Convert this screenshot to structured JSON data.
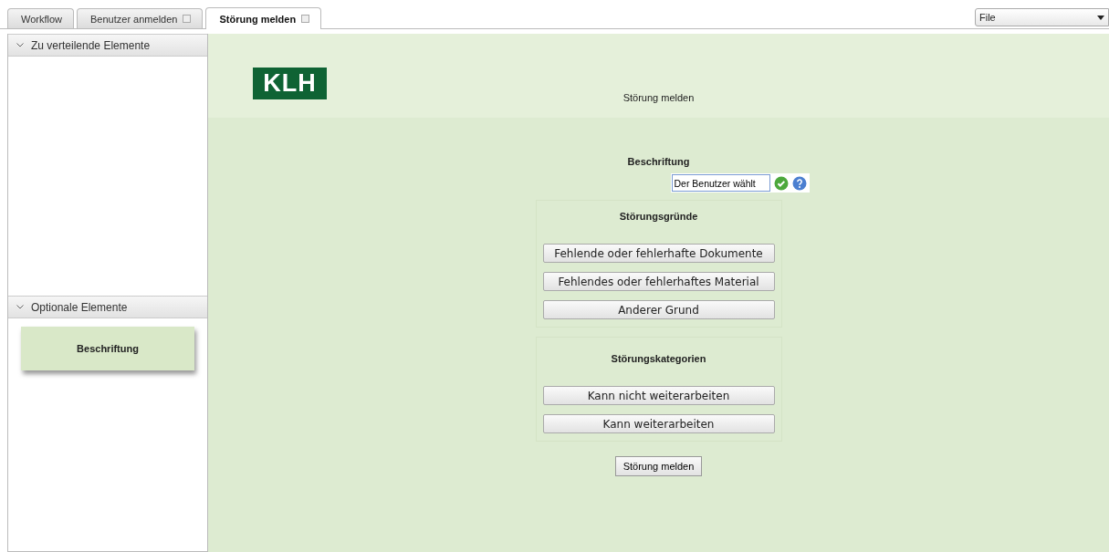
{
  "tabs": [
    {
      "label": "Workflow",
      "selected": false,
      "closable": false
    },
    {
      "label": "Benutzer anmelden",
      "selected": false,
      "closable": true
    },
    {
      "label": "Störung melden",
      "selected": true,
      "closable": true
    }
  ],
  "menu_dropdown": {
    "value": "File"
  },
  "sidebar": {
    "sections": [
      {
        "title": "Zu verteilende Elemente",
        "expanded": true
      },
      {
        "title": "Optionale Elemente",
        "expanded": true,
        "items": [
          "Beschriftung"
        ]
      }
    ]
  },
  "header": {
    "logo": "KLH",
    "title": "Störung melden"
  },
  "form": {
    "field_label": "Beschriftung",
    "field_value": "Der Benutzer wählt",
    "groups": [
      {
        "title": "Störungsgründe",
        "buttons": [
          "Fehlende oder fehlerhafte Dokumente",
          "Fehlendes oder fehlerhaftes Material",
          "Anderer Grund"
        ]
      },
      {
        "title": "Störungskategorien",
        "buttons": [
          "Kann nicht weiterarbeiten",
          "Kann weiterarbeiten"
        ]
      }
    ],
    "submit": "Störung melden"
  }
}
